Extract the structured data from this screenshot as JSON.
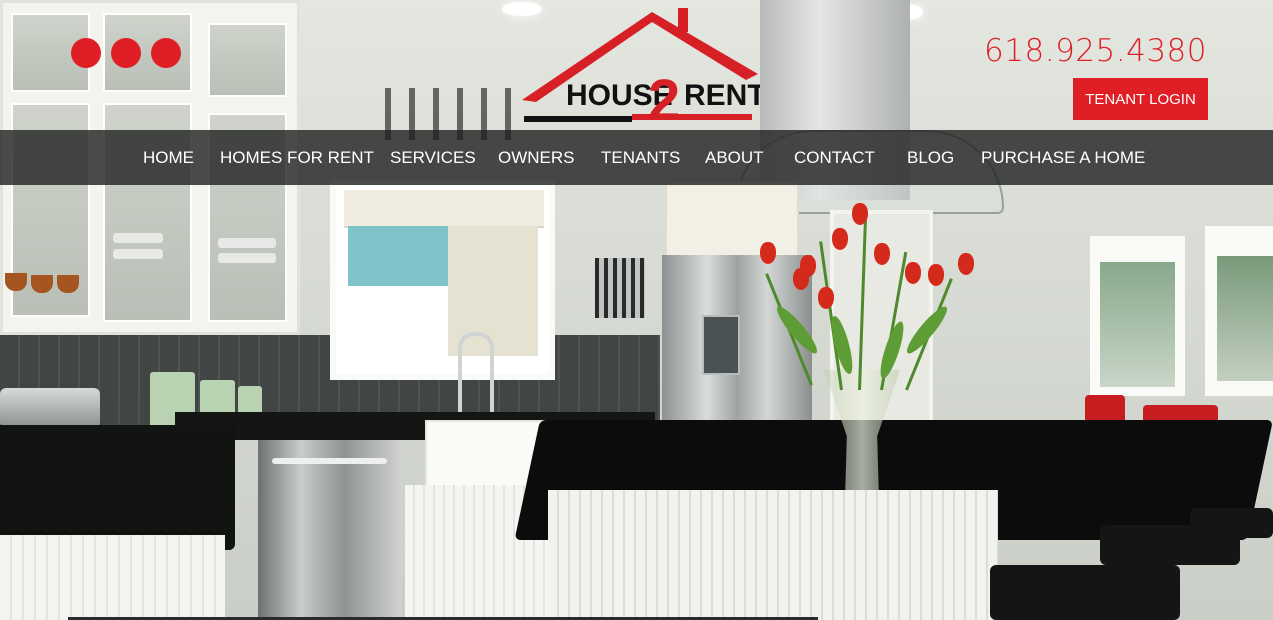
{
  "header": {
    "phone": "618.925.4380",
    "tenant_login": "TENANT LOGIN",
    "logo": {
      "text_left": "HOUSE",
      "text_digit": "2",
      "text_right": "RENT"
    },
    "decor_dots": 3
  },
  "nav": {
    "items": [
      {
        "label": "HOME"
      },
      {
        "label": "HOMES FOR RENT"
      },
      {
        "label": "SERVICES"
      },
      {
        "label": "OWNERS"
      },
      {
        "label": "TENANTS"
      },
      {
        "label": "ABOUT"
      },
      {
        "label": "CONTACT"
      },
      {
        "label": "BLOG"
      },
      {
        "label": "PURCHASE A HOME"
      }
    ]
  },
  "colors": {
    "accent": "#e01e25",
    "nav_background": "#1e201f",
    "text_light": "#ffffff"
  },
  "icons": {
    "logo_roof": "house-roof-icon"
  }
}
